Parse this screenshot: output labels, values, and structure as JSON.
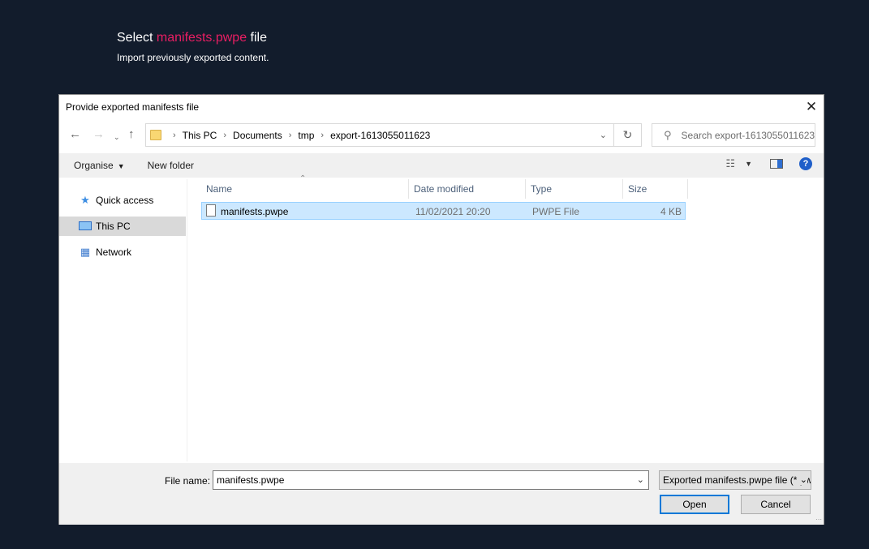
{
  "page": {
    "title_prefix": "Select",
    "title_highlight": "manifests.pwpe",
    "title_suffix": "file",
    "subtitle": "Import previously exported content.",
    "accent_color": "#e91e63",
    "background_color": "#121c2c"
  },
  "dialog": {
    "title": "Provide exported manifests file",
    "close_glyph": "✕",
    "breadcrumb": [
      "This PC",
      "Documents",
      "tmp",
      "export-1613055011623"
    ],
    "search_placeholder": "Search export-1613055011623",
    "toolbar": {
      "organise_label": "Organise",
      "new_folder_label": "New folder"
    },
    "nav_pane": {
      "items": [
        {
          "label": "Quick access",
          "icon": "star-icon",
          "selected": false
        },
        {
          "label": "This PC",
          "icon": "computer-icon",
          "selected": true
        },
        {
          "label": "Network",
          "icon": "network-icon",
          "selected": false
        }
      ]
    },
    "columns": [
      "Name",
      "Date modified",
      "Type",
      "Size"
    ],
    "files": [
      {
        "name": "manifests.pwpe",
        "date_modified": "11/02/2021 20:20",
        "type": "PWPE File",
        "size": "4 KB",
        "selected": true
      }
    ],
    "file_name_label": "File name:",
    "file_name_value": "manifests.pwpe",
    "file_type_filter": "Exported manifests.pwpe file (*.pwpe)",
    "open_label": "Open",
    "cancel_label": "Cancel"
  }
}
